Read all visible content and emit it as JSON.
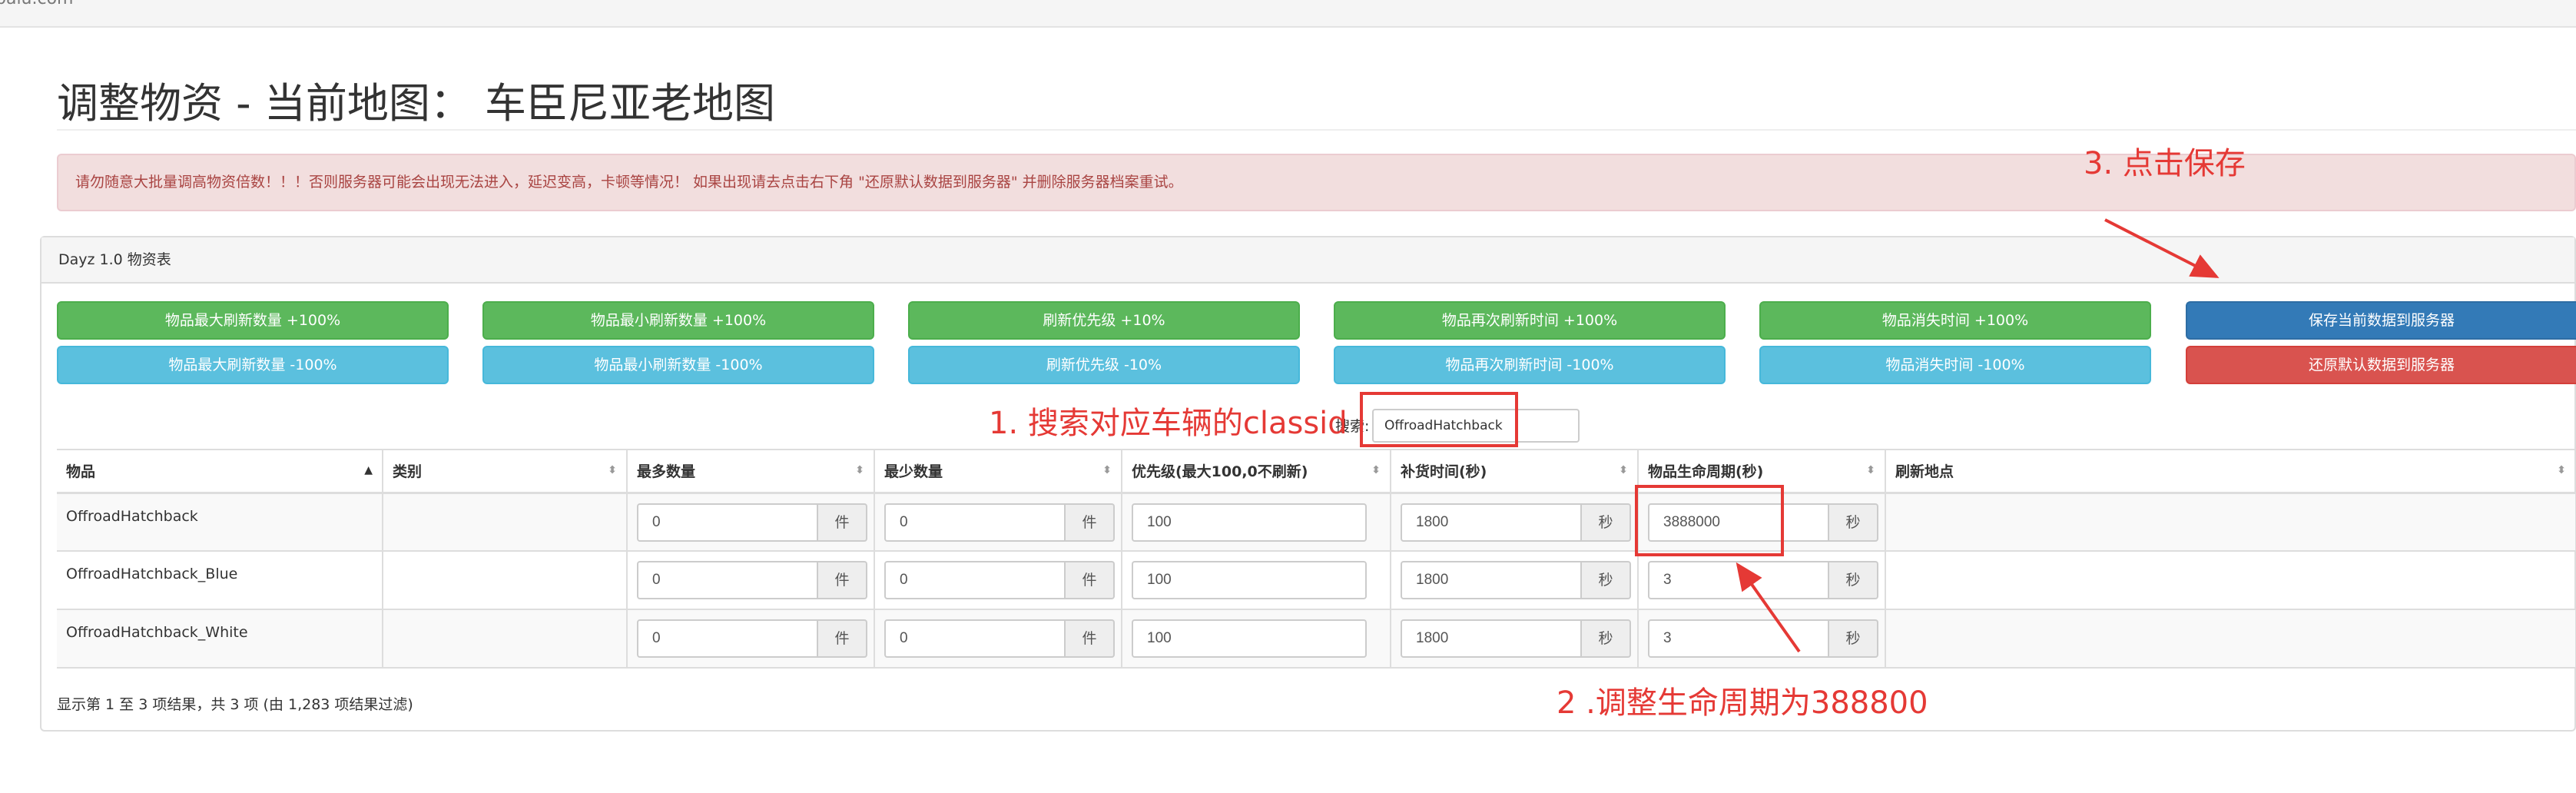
{
  "browser": {
    "url_fragment": "baiu.com"
  },
  "page": {
    "title": "调整物资 - 当前地图： 车臣尼亚老地图"
  },
  "alert": {
    "text": "请勿随意大批量调高物资倍数！！！否则服务器可能会出现无法进入，延迟变高，卡顿等情况！ 如果出现请去点击右下角 \"还原默认数据到服务器\" 并删除服务器档案重试。"
  },
  "panel": {
    "heading": "Dayz 1.0 物资表"
  },
  "buttons": {
    "max_plus": "物品最大刷新数量 +100%",
    "max_minus": "物品最大刷新数量 -100%",
    "min_plus": "物品最小刷新数量 +100%",
    "min_minus": "物品最小刷新数量 -100%",
    "prio_plus": "刷新优先级 +10%",
    "prio_minus": "刷新优先级 -10%",
    "restock_plus": "物品再次刷新时间 +100%",
    "restock_minus": "物品再次刷新时间 -100%",
    "lifetime_plus": "物品消失时间 +100%",
    "lifetime_minus": "物品消失时间 -100%",
    "save": "保存当前数据到服务器",
    "restore": "还原默认数据到服务器"
  },
  "search": {
    "label": "搜索:",
    "value": "OffroadHatchback"
  },
  "table": {
    "headers": [
      "物品",
      "类别",
      "最多数量",
      "最少数量",
      "优先级(最大100,0不刷新)",
      "补货时间(秒)",
      "物品生命周期(秒)",
      "刷新地点"
    ],
    "unit_piece": "件",
    "unit_second": "秒",
    "rows": [
      {
        "name": "OffroadHatchback",
        "category": "",
        "max": "0",
        "min": "0",
        "priority": "100",
        "restock": "1800",
        "lifetime": "3888000"
      },
      {
        "name": "OffroadHatchback_Blue",
        "category": "",
        "max": "0",
        "min": "0",
        "priority": "100",
        "restock": "1800",
        "lifetime": "3"
      },
      {
        "name": "OffroadHatchback_White",
        "category": "",
        "max": "0",
        "min": "0",
        "priority": "100",
        "restock": "1800",
        "lifetime": "3"
      }
    ],
    "info": "显示第 1 至 3 项结果，共 3 项 (由 1,283 项结果过滤)"
  },
  "annotations": {
    "step1": "1. 搜索对应车辆的classid",
    "step2": "2 .调整生命周期为388800",
    "step3": "3. 点击保存",
    "color": "#e53935"
  },
  "colors": {
    "success": "#5cb85c",
    "info": "#5bc0de",
    "primary": "#337ab7",
    "danger": "#d9534f",
    "alert_bg": "#f2dede",
    "alert_text": "#a94442"
  }
}
